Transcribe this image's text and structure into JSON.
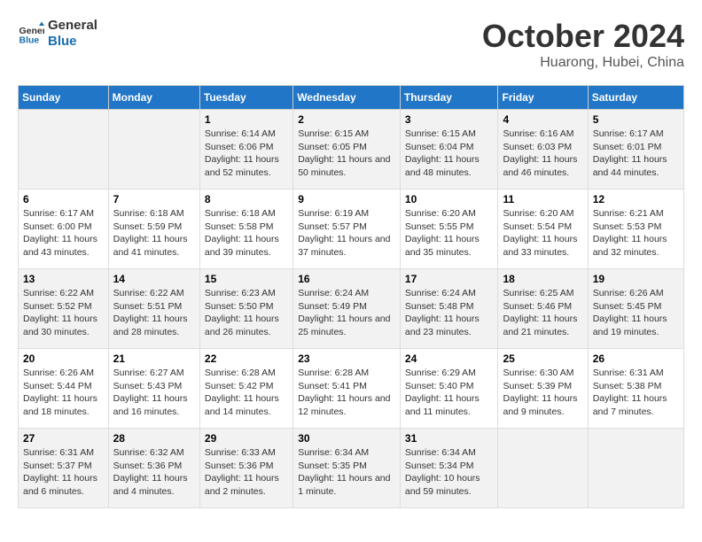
{
  "header": {
    "logo_line1": "General",
    "logo_line2": "Blue",
    "month": "October 2024",
    "location": "Huarong, Hubei, China"
  },
  "weekdays": [
    "Sunday",
    "Monday",
    "Tuesday",
    "Wednesday",
    "Thursday",
    "Friday",
    "Saturday"
  ],
  "weeks": [
    [
      {
        "day": "",
        "info": ""
      },
      {
        "day": "",
        "info": ""
      },
      {
        "day": "1",
        "info": "Sunrise: 6:14 AM\nSunset: 6:06 PM\nDaylight: 11 hours and 52 minutes."
      },
      {
        "day": "2",
        "info": "Sunrise: 6:15 AM\nSunset: 6:05 PM\nDaylight: 11 hours and 50 minutes."
      },
      {
        "day": "3",
        "info": "Sunrise: 6:15 AM\nSunset: 6:04 PM\nDaylight: 11 hours and 48 minutes."
      },
      {
        "day": "4",
        "info": "Sunrise: 6:16 AM\nSunset: 6:03 PM\nDaylight: 11 hours and 46 minutes."
      },
      {
        "day": "5",
        "info": "Sunrise: 6:17 AM\nSunset: 6:01 PM\nDaylight: 11 hours and 44 minutes."
      }
    ],
    [
      {
        "day": "6",
        "info": "Sunrise: 6:17 AM\nSunset: 6:00 PM\nDaylight: 11 hours and 43 minutes."
      },
      {
        "day": "7",
        "info": "Sunrise: 6:18 AM\nSunset: 5:59 PM\nDaylight: 11 hours and 41 minutes."
      },
      {
        "day": "8",
        "info": "Sunrise: 6:18 AM\nSunset: 5:58 PM\nDaylight: 11 hours and 39 minutes."
      },
      {
        "day": "9",
        "info": "Sunrise: 6:19 AM\nSunset: 5:57 PM\nDaylight: 11 hours and 37 minutes."
      },
      {
        "day": "10",
        "info": "Sunrise: 6:20 AM\nSunset: 5:55 PM\nDaylight: 11 hours and 35 minutes."
      },
      {
        "day": "11",
        "info": "Sunrise: 6:20 AM\nSunset: 5:54 PM\nDaylight: 11 hours and 33 minutes."
      },
      {
        "day": "12",
        "info": "Sunrise: 6:21 AM\nSunset: 5:53 PM\nDaylight: 11 hours and 32 minutes."
      }
    ],
    [
      {
        "day": "13",
        "info": "Sunrise: 6:22 AM\nSunset: 5:52 PM\nDaylight: 11 hours and 30 minutes."
      },
      {
        "day": "14",
        "info": "Sunrise: 6:22 AM\nSunset: 5:51 PM\nDaylight: 11 hours and 28 minutes."
      },
      {
        "day": "15",
        "info": "Sunrise: 6:23 AM\nSunset: 5:50 PM\nDaylight: 11 hours and 26 minutes."
      },
      {
        "day": "16",
        "info": "Sunrise: 6:24 AM\nSunset: 5:49 PM\nDaylight: 11 hours and 25 minutes."
      },
      {
        "day": "17",
        "info": "Sunrise: 6:24 AM\nSunset: 5:48 PM\nDaylight: 11 hours and 23 minutes."
      },
      {
        "day": "18",
        "info": "Sunrise: 6:25 AM\nSunset: 5:46 PM\nDaylight: 11 hours and 21 minutes."
      },
      {
        "day": "19",
        "info": "Sunrise: 6:26 AM\nSunset: 5:45 PM\nDaylight: 11 hours and 19 minutes."
      }
    ],
    [
      {
        "day": "20",
        "info": "Sunrise: 6:26 AM\nSunset: 5:44 PM\nDaylight: 11 hours and 18 minutes."
      },
      {
        "day": "21",
        "info": "Sunrise: 6:27 AM\nSunset: 5:43 PM\nDaylight: 11 hours and 16 minutes."
      },
      {
        "day": "22",
        "info": "Sunrise: 6:28 AM\nSunset: 5:42 PM\nDaylight: 11 hours and 14 minutes."
      },
      {
        "day": "23",
        "info": "Sunrise: 6:28 AM\nSunset: 5:41 PM\nDaylight: 11 hours and 12 minutes."
      },
      {
        "day": "24",
        "info": "Sunrise: 6:29 AM\nSunset: 5:40 PM\nDaylight: 11 hours and 11 minutes."
      },
      {
        "day": "25",
        "info": "Sunrise: 6:30 AM\nSunset: 5:39 PM\nDaylight: 11 hours and 9 minutes."
      },
      {
        "day": "26",
        "info": "Sunrise: 6:31 AM\nSunset: 5:38 PM\nDaylight: 11 hours and 7 minutes."
      }
    ],
    [
      {
        "day": "27",
        "info": "Sunrise: 6:31 AM\nSunset: 5:37 PM\nDaylight: 11 hours and 6 minutes."
      },
      {
        "day": "28",
        "info": "Sunrise: 6:32 AM\nSunset: 5:36 PM\nDaylight: 11 hours and 4 minutes."
      },
      {
        "day": "29",
        "info": "Sunrise: 6:33 AM\nSunset: 5:36 PM\nDaylight: 11 hours and 2 minutes."
      },
      {
        "day": "30",
        "info": "Sunrise: 6:34 AM\nSunset: 5:35 PM\nDaylight: 11 hours and 1 minute."
      },
      {
        "day": "31",
        "info": "Sunrise: 6:34 AM\nSunset: 5:34 PM\nDaylight: 10 hours and 59 minutes."
      },
      {
        "day": "",
        "info": ""
      },
      {
        "day": "",
        "info": ""
      }
    ]
  ]
}
